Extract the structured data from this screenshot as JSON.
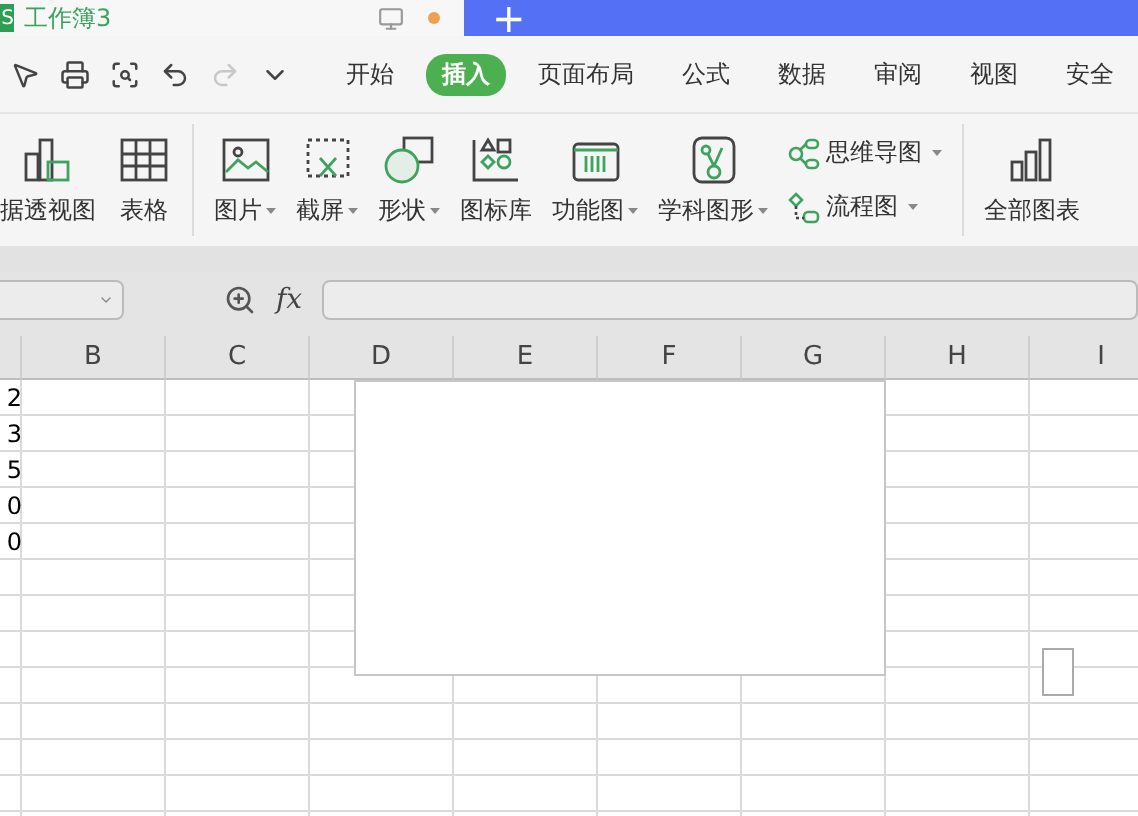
{
  "title_bar": {
    "app_badge": "S",
    "document_title": "工作簿3",
    "new_tab_button": "+"
  },
  "menu_tabs": [
    {
      "label": "开始",
      "selected": false
    },
    {
      "label": "插入",
      "selected": true
    },
    {
      "label": "页面布局",
      "selected": false
    },
    {
      "label": "公式",
      "selected": false
    },
    {
      "label": "数据",
      "selected": false
    },
    {
      "label": "审阅",
      "selected": false
    },
    {
      "label": "视图",
      "selected": false
    },
    {
      "label": "安全",
      "selected": false
    }
  ],
  "quick_access": [
    {
      "kind": "cursor",
      "disabled": false
    },
    {
      "kind": "print",
      "disabled": false
    },
    {
      "kind": "preview",
      "disabled": false
    },
    {
      "kind": "undo",
      "disabled": false
    },
    {
      "kind": "redo",
      "disabled": true
    },
    {
      "kind": "more",
      "disabled": false
    }
  ],
  "ribbon_groups": [
    [
      {
        "kind": "pivot",
        "label": "据透视图",
        "dropdown": false
      },
      {
        "kind": "table",
        "label": "表格",
        "dropdown": false
      }
    ],
    [
      {
        "kind": "picture",
        "label": "图片",
        "dropdown": true
      },
      {
        "kind": "screenshot",
        "label": "截屏",
        "dropdown": true
      },
      {
        "kind": "shape",
        "label": "形状",
        "dropdown": true
      },
      {
        "kind": "iconlib",
        "label": "图标库",
        "dropdown": false
      },
      {
        "kind": "function",
        "label": "功能图",
        "dropdown": true
      },
      {
        "kind": "science",
        "label": "学科图形",
        "dropdown": true
      },
      {
        "kind": "stack",
        "items": [
          {
            "kind": "mindmap",
            "label": "思维导图",
            "dropdown": true
          },
          {
            "kind": "flow",
            "label": "流程图",
            "dropdown": true
          }
        ]
      }
    ],
    [
      {
        "kind": "allcharts",
        "label": "全部图表",
        "dropdown": false
      }
    ]
  ],
  "formula_bar": {
    "fx_label": "fx"
  },
  "sheet": {
    "columns": [
      "B",
      "C",
      "D",
      "E",
      "F",
      "G",
      "H",
      "I"
    ],
    "column_a_values": [
      "2",
      "3",
      "5",
      "0",
      "0"
    ]
  }
}
